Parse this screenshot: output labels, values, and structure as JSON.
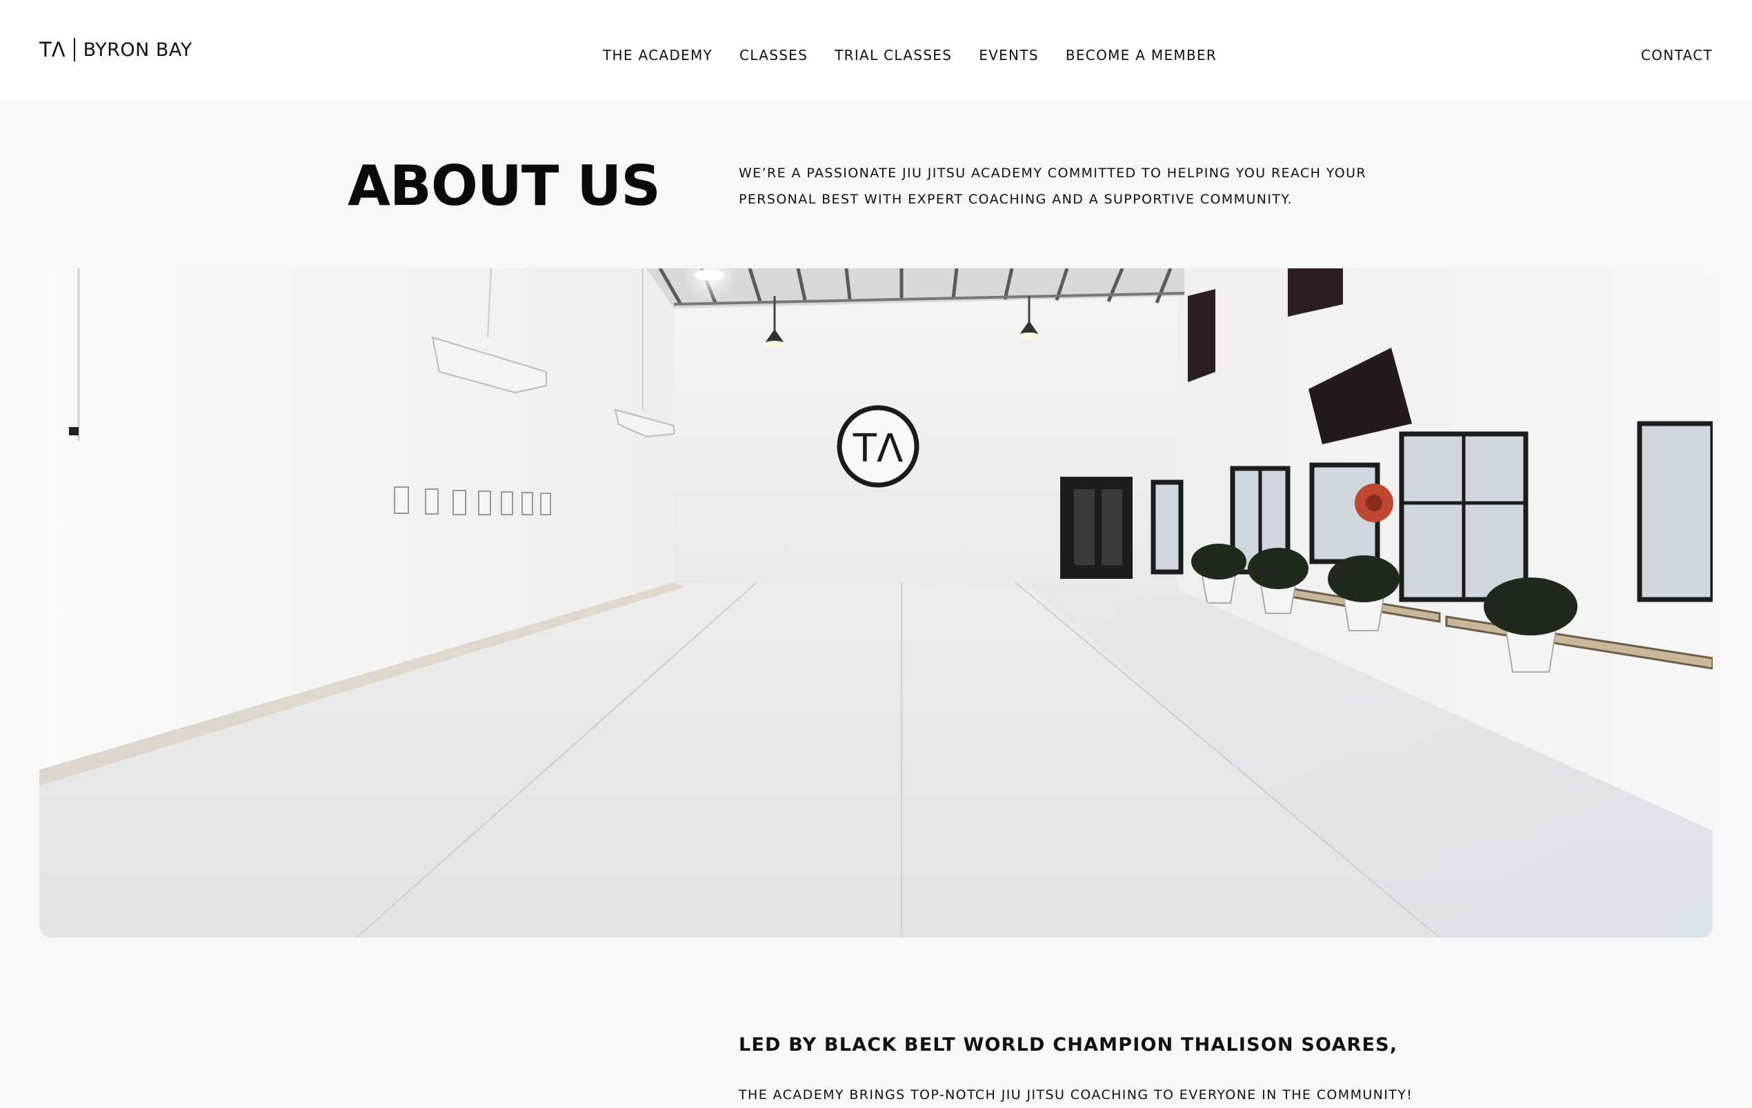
{
  "header": {
    "logo_mark": "TΛ",
    "logo_text": "BYRON BAY",
    "nav": [
      {
        "label": "THE ACADEMY"
      },
      {
        "label": "CLASSES"
      },
      {
        "label": "TRIAL CLASSES"
      },
      {
        "label": "EVENTS"
      },
      {
        "label": "BECOME A MEMBER"
      }
    ],
    "contact_label": "CONTACT"
  },
  "about": {
    "title": "ABOUT US",
    "intro": "WE’RE A PASSIONATE JIU JITSU ACADEMY COMMITTED TO HELPING YOU REACH YOUR PERSONAL BEST WITH EXPERT COACHING AND A SUPPORTIVE COMMUNITY."
  },
  "hero": {
    "wall_logo": "TΛ"
  },
  "lead": {
    "heading": "LED BY BLACK BELT WORLD CHAMPION THALISON SOARES,",
    "body": "THE ACADEMY BRINGS TOP-NOTCH JIU JITSU COACHING TO EVERYONE IN THE COMMUNITY!"
  },
  "colors": {
    "page_background": "#f7f7f7",
    "header_background": "#ffffff",
    "text": "#111111"
  }
}
